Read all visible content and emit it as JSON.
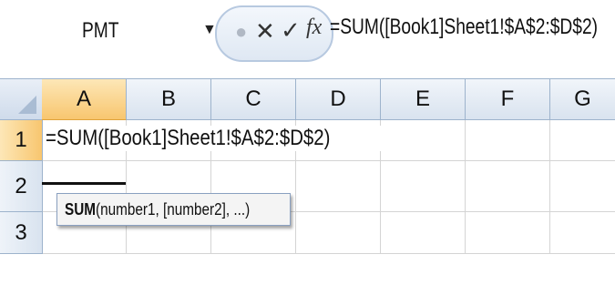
{
  "formula_bar": {
    "name_box": "PMT",
    "name_box_arrow": "▼",
    "cancel_glyph": "✕",
    "enter_glyph": "✓",
    "fx_label": "fx",
    "formula": "=SUM([Book1]Sheet1!$A$2:$D$2)"
  },
  "grid": {
    "columns": [
      "A",
      "B",
      "C",
      "D",
      "E",
      "F",
      "G"
    ],
    "rows": [
      "1",
      "2",
      "3"
    ],
    "active_column": "A",
    "active_row": "1",
    "edit_text": "=SUM([Book1]Sheet1!$A$2:$D$2)"
  },
  "tooltip": {
    "function_name": "SUM",
    "arguments": "(number1, [number2], ...)"
  },
  "colors": {
    "header_bg": "#d9e3ef",
    "active_header": "#f8c66f",
    "grid_line": "#d4d4d4"
  }
}
